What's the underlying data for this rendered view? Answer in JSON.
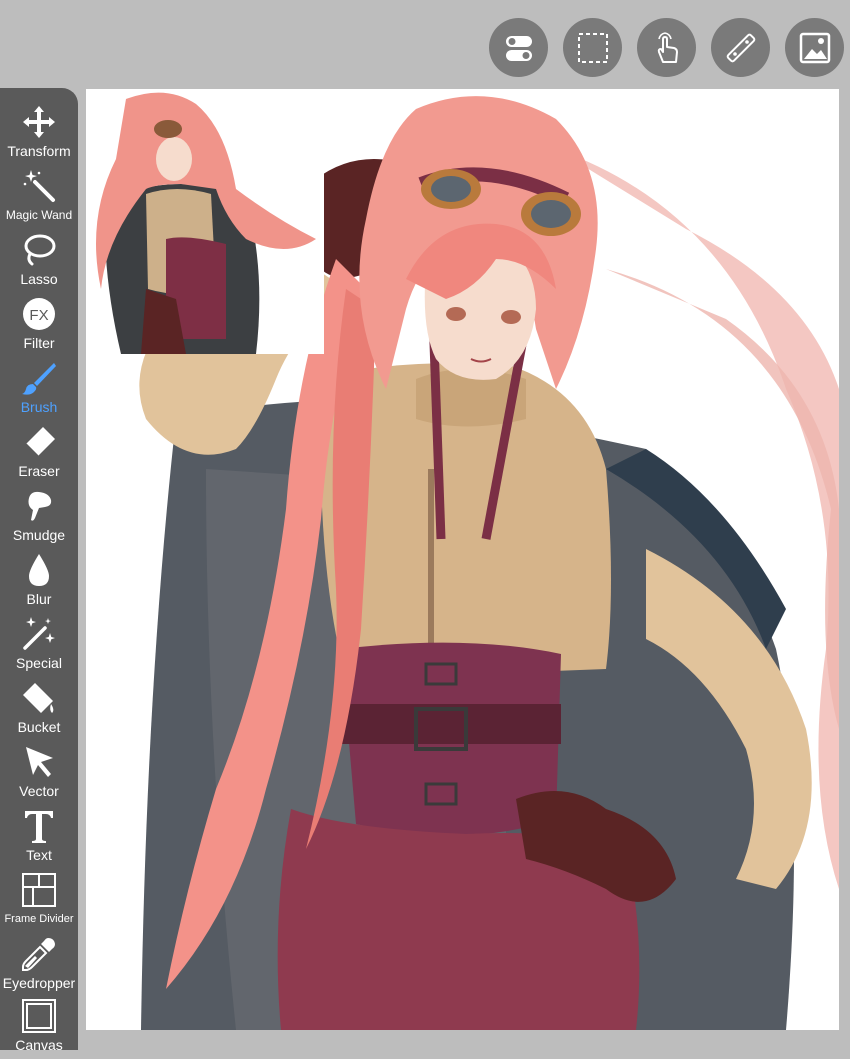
{
  "top_tools": [
    {
      "name": "toggle-icon"
    },
    {
      "name": "selection-icon"
    },
    {
      "name": "touch-icon"
    },
    {
      "name": "ruler-icon"
    },
    {
      "name": "image-icon"
    }
  ],
  "toolbar": {
    "items": [
      {
        "label": "Transform",
        "icon": "transform-icon"
      },
      {
        "label": "Magic Wand",
        "icon": "magic-wand-icon"
      },
      {
        "label": "Lasso",
        "icon": "lasso-icon"
      },
      {
        "label": "Filter",
        "icon": "filter-icon"
      },
      {
        "label": "Brush",
        "icon": "brush-icon",
        "active": true
      },
      {
        "label": "Eraser",
        "icon": "eraser-icon"
      },
      {
        "label": "Smudge",
        "icon": "smudge-icon"
      },
      {
        "label": "Blur",
        "icon": "blur-icon"
      },
      {
        "label": "Special",
        "icon": "special-icon"
      },
      {
        "label": "Bucket",
        "icon": "bucket-icon"
      },
      {
        "label": "Vector",
        "icon": "vector-icon"
      },
      {
        "label": "Text",
        "icon": "text-icon"
      },
      {
        "label": "Frame Divider",
        "icon": "frame-divider-icon"
      },
      {
        "label": "Eyedropper",
        "icon": "eyedropper-icon"
      },
      {
        "label": "Canvas",
        "icon": "canvas-icon"
      }
    ]
  },
  "colors": {
    "accent": "#4ea1ff",
    "toolbar_bg": "#5a5a5a",
    "app_bg": "#bdbdbd",
    "button_bg": "#7a7a7a"
  }
}
